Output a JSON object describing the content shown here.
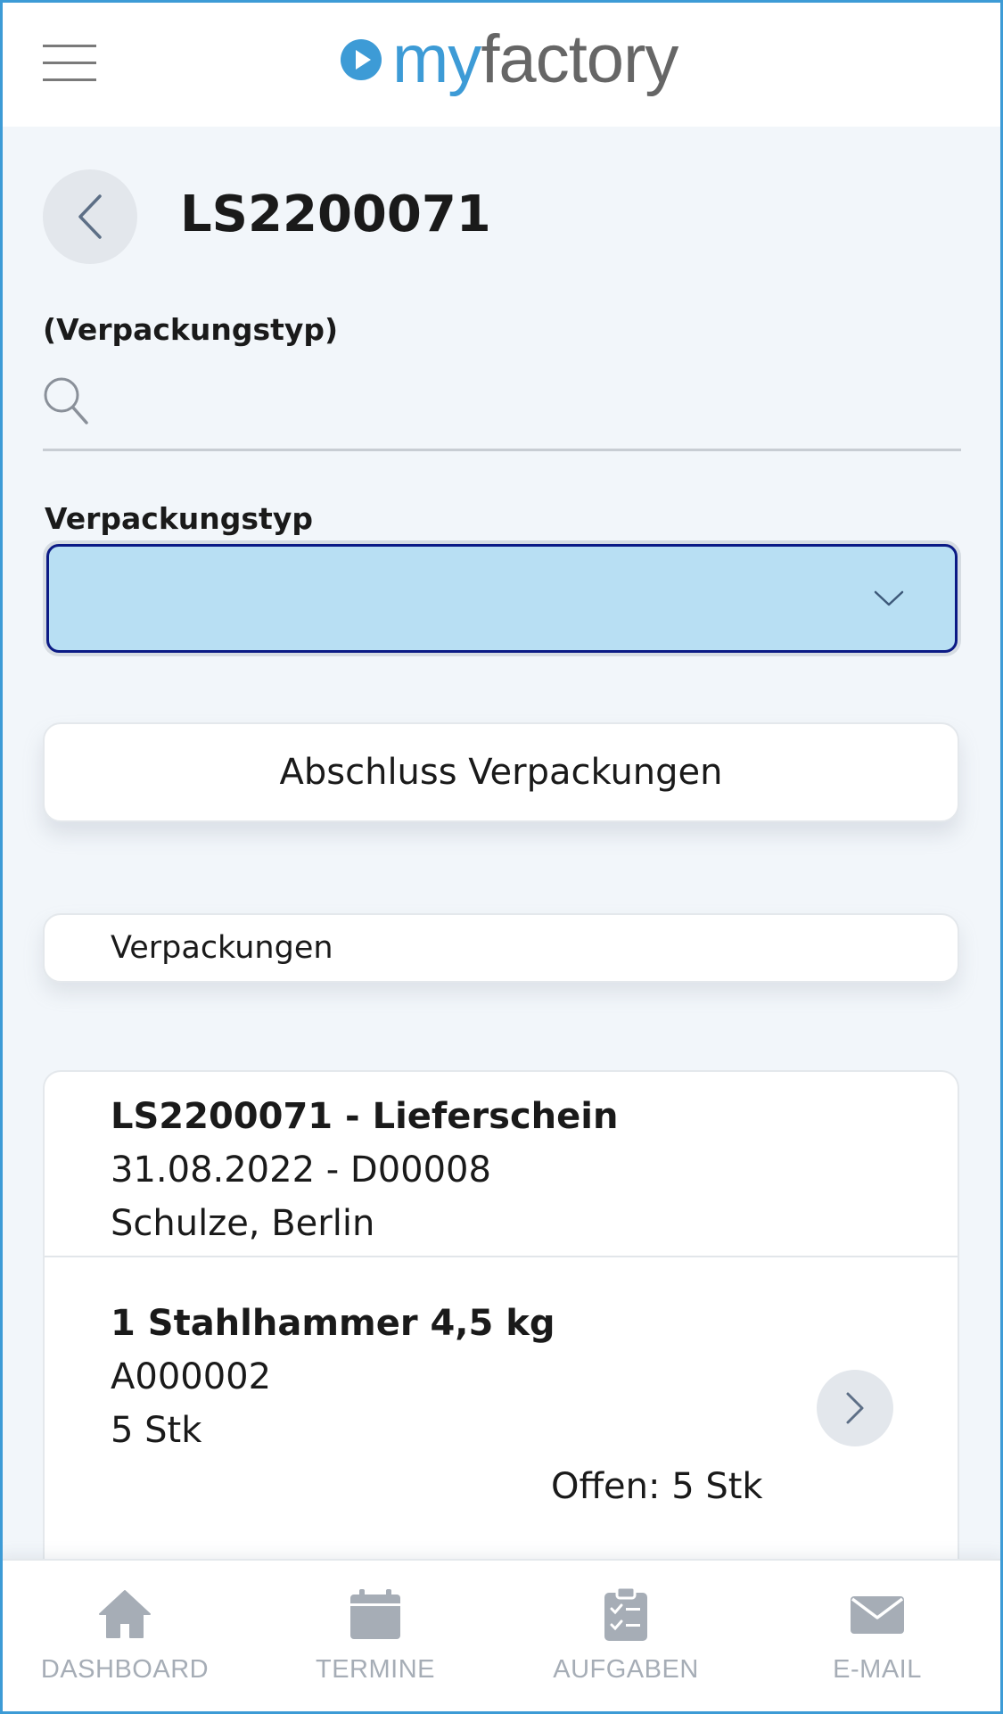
{
  "header": {
    "logo_my": "my",
    "logo_factory": "factory",
    "menu_icon": "hamburger-icon",
    "logo_icon": "play-circle-icon"
  },
  "page": {
    "title": "LS2200071",
    "back_icon": "chevron-left-icon"
  },
  "search": {
    "label": "(Verpackungstyp)",
    "value": "",
    "icon": "search-icon"
  },
  "packaging_select": {
    "label": "Verpackungstyp",
    "selected": "",
    "icon": "chevron-down-icon"
  },
  "finish_button": {
    "label": "Abschluss Verpackungen"
  },
  "section_tab": {
    "label": "Verpackungen"
  },
  "delivery": {
    "title": "LS2200071 - Lieferschein",
    "date_customer": "31.08.2022 - D00008",
    "address": "Schulze, Berlin"
  },
  "item": {
    "name": "1 Stahlhammer 4,5 kg",
    "article_no": "A000002",
    "quantity": "5 Stk",
    "open": "Offen: 5 Stk",
    "arrow_icon": "chevron-right-icon"
  },
  "bottom_nav": {
    "items": [
      {
        "label": "DASHBOARD",
        "icon": "home-icon"
      },
      {
        "label": "TERMINE",
        "icon": "calendar-icon"
      },
      {
        "label": "AUFGABEN",
        "icon": "clipboard-check-icon"
      },
      {
        "label": "E-MAIL",
        "icon": "envelope-icon"
      }
    ]
  },
  "colors": {
    "brand_blue": "#3d9bd6",
    "select_fill": "#b8dff3",
    "select_border": "#0b1a85",
    "nav_inactive": "#a6adb6",
    "background": "#f2f6fa"
  }
}
